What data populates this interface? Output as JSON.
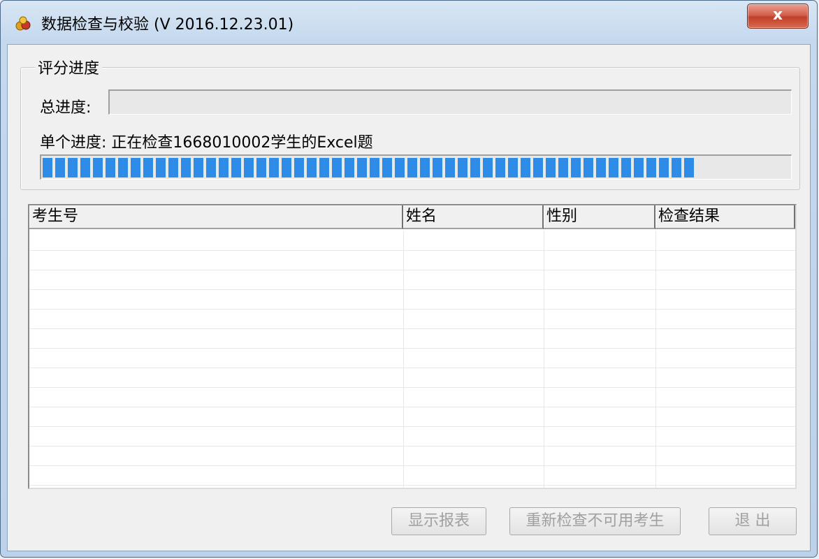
{
  "window": {
    "title": "数据检查与校验 (V 2016.12.23.01)",
    "close_label": "x"
  },
  "progress_group": {
    "title": "评分进度",
    "total_label": "总进度:",
    "total_progress": 0,
    "single_label": "单个进度: 正在检查1668010002学生的Excel题",
    "single_progress": 0.875,
    "bar_color": "#2d8ce8"
  },
  "table": {
    "columns": [
      "考生号",
      "姓名",
      "性别",
      "检查结果"
    ],
    "rows": []
  },
  "buttons": {
    "show_report": "显示报表",
    "recheck": "重新检查不可用考生",
    "exit": "退  出"
  }
}
